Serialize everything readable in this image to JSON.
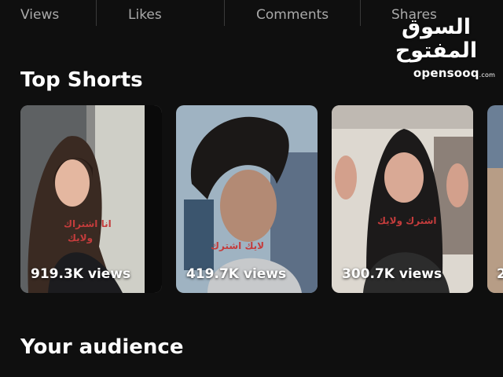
{
  "tabs": [
    "Views",
    "Likes",
    "Comments",
    "Shares"
  ],
  "watermark": {
    "arabic": "السوق المفتوح",
    "latin": "opensooq",
    "suffix": ".com"
  },
  "top_shorts": {
    "title": "Top Shorts",
    "items": [
      {
        "views": "919.3K views",
        "overlay_text": [
          "انا اشتراك",
          "ولايك"
        ]
      },
      {
        "views": "419.7K views",
        "overlay_text": [
          "لايك اشترك"
        ]
      },
      {
        "views": "300.7K views",
        "overlay_text": [
          "اشترك ولايك"
        ]
      },
      {
        "views": "2"
      }
    ]
  },
  "audience": {
    "title": "Your audience"
  },
  "colors": {
    "background": "#0f0f0f",
    "tab_text": "#aaaaaa",
    "text": "#ffffff"
  }
}
